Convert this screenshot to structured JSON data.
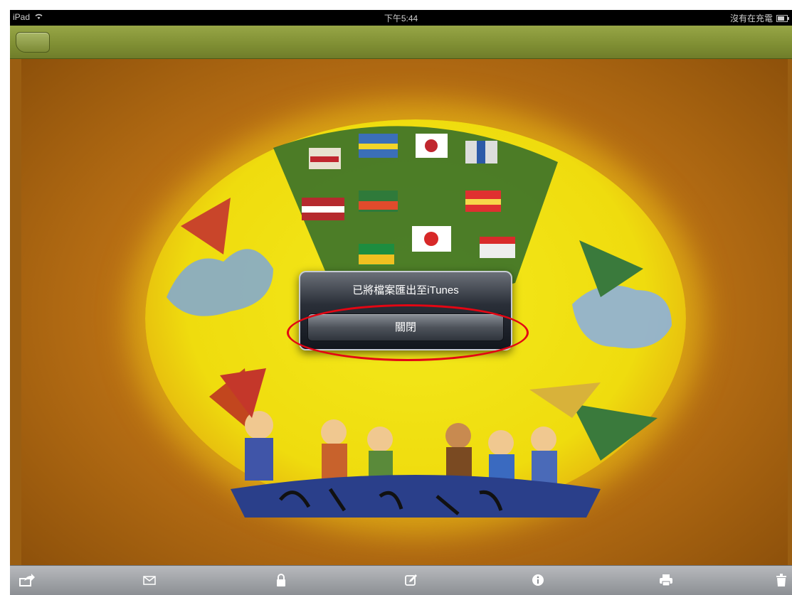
{
  "status_bar": {
    "device": "iPad",
    "time": "下午5:44",
    "charging": "沒有在充電"
  },
  "dialog": {
    "message": "已將檔案匯出至iTunes",
    "button": "關閉"
  },
  "toolbar": {
    "icons": [
      "share-icon",
      "mail-icon",
      "lock-icon",
      "edit-icon",
      "info-icon",
      "print-icon",
      "trash-icon"
    ]
  },
  "colors": {
    "navbar": "#7f8e33",
    "background": "#b86f14",
    "highlight": "#e30613"
  }
}
